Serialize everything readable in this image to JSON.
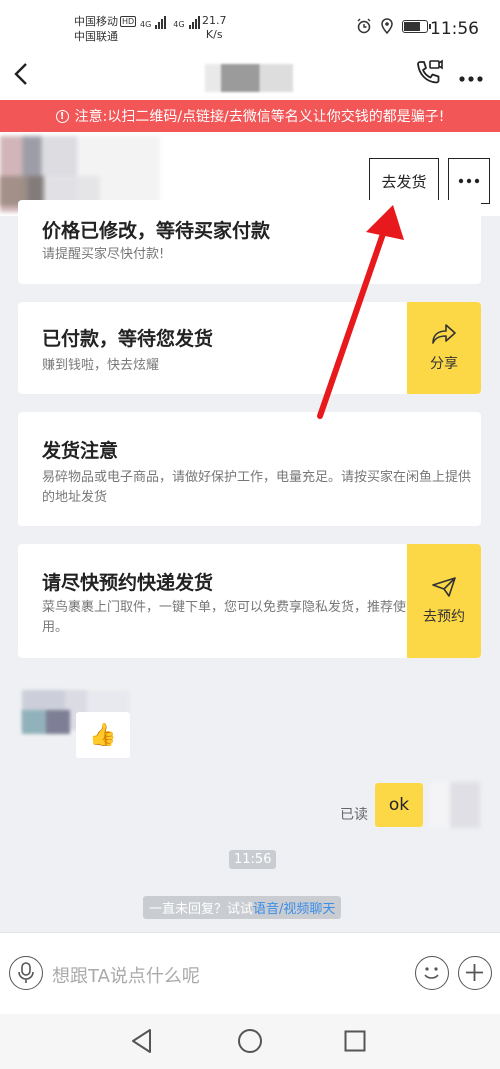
{
  "status_bar": {
    "carrier_1": "中国移动",
    "hd_badge": "HD",
    "carrier_2": "中国联通",
    "net_1": "4G",
    "net_2": "4G",
    "speed_value": "21.7",
    "speed_unit": "K/s",
    "time": "11:56",
    "battery_level": 0.8,
    "icons": [
      "alarm-icon",
      "location-icon",
      "battery-icon"
    ]
  },
  "header": {
    "back_icon": "back-arrow-icon",
    "call_icon": "video-call-icon",
    "more_icon": "more-dots-icon"
  },
  "warning": {
    "icon": "alert-circle-icon",
    "text": "注意:以扫二维码/点链接/去微信等名义让你交钱的都是骗子!"
  },
  "top_actions": {
    "ship_button": "去发货",
    "more_button": "···"
  },
  "cards": [
    {
      "title": "价格已修改，等待买家付款",
      "subtitle": "请提醒买家尽快付款!"
    },
    {
      "title": "已付款，等待您发货",
      "subtitle": "赚到钱啦，快去炫耀",
      "action": "分享",
      "action_icon": "share-icon"
    },
    {
      "title": "发货注意",
      "subtitle": "易碎物品或电子商品，请做好保护工作，电量充足。请按买家在闲鱼上提供的地址发货"
    },
    {
      "title": "请尽快预约快递发货",
      "subtitle": "菜鸟裹裹上门取件，一键下单，您可以免费享隐私发货，推荐使用。",
      "action": "去预约",
      "action_icon": "paper-plane-icon"
    }
  ],
  "chat": {
    "received_emoji": "👍",
    "read_label": "已读",
    "sent_text": "ok",
    "timestamp": "11:56",
    "hint_prefix": "一直未回复？试试",
    "hint_link": "语音/视频聊天"
  },
  "input": {
    "placeholder": "想跟TA说点什么呢"
  },
  "colors": {
    "accent_yellow": "#fcd847",
    "warning_red": "#f25657",
    "annotation_red": "#e8191c",
    "link_blue": "#3b8ee8"
  }
}
